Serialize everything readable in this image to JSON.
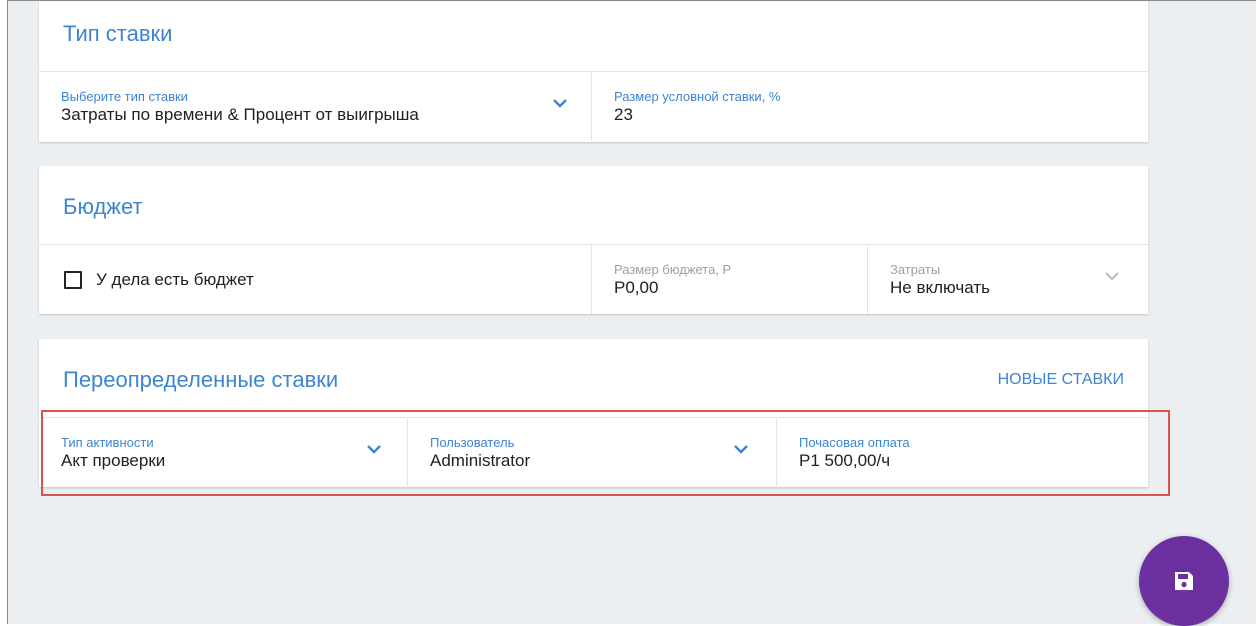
{
  "rate_type": {
    "title": "Тип ставки",
    "select_label": "Выберите тип ставки",
    "select_value": "Затраты по времени & Процент от выигрыша",
    "conditional_label": "Размер условной ставки, %",
    "conditional_value": "23"
  },
  "budget": {
    "title": "Бюджет",
    "has_budget_label": "У дела есть бюджет",
    "has_budget_checked": false,
    "amount_label": "Размер бюджета, Р",
    "amount_value": "Р0,00",
    "expenses_label": "Затраты",
    "expenses_value": "Не включать"
  },
  "overrides": {
    "title": "Переопределенные ставки",
    "new_rates_label": "НОВЫЕ СТАВКИ",
    "activity_label": "Тип активности",
    "activity_value": "Акт проверки",
    "user_label": "Пользователь",
    "user_value": "Administrator",
    "hourly_label": "Почасовая оплата",
    "hourly_value": "Р1 500,00/ч"
  },
  "fab": {
    "icon": "save-icon"
  },
  "colors": {
    "accent": "#3d84d3",
    "fab": "#6b2fa0",
    "highlight": "#d9534f",
    "background": "#eceff1"
  }
}
